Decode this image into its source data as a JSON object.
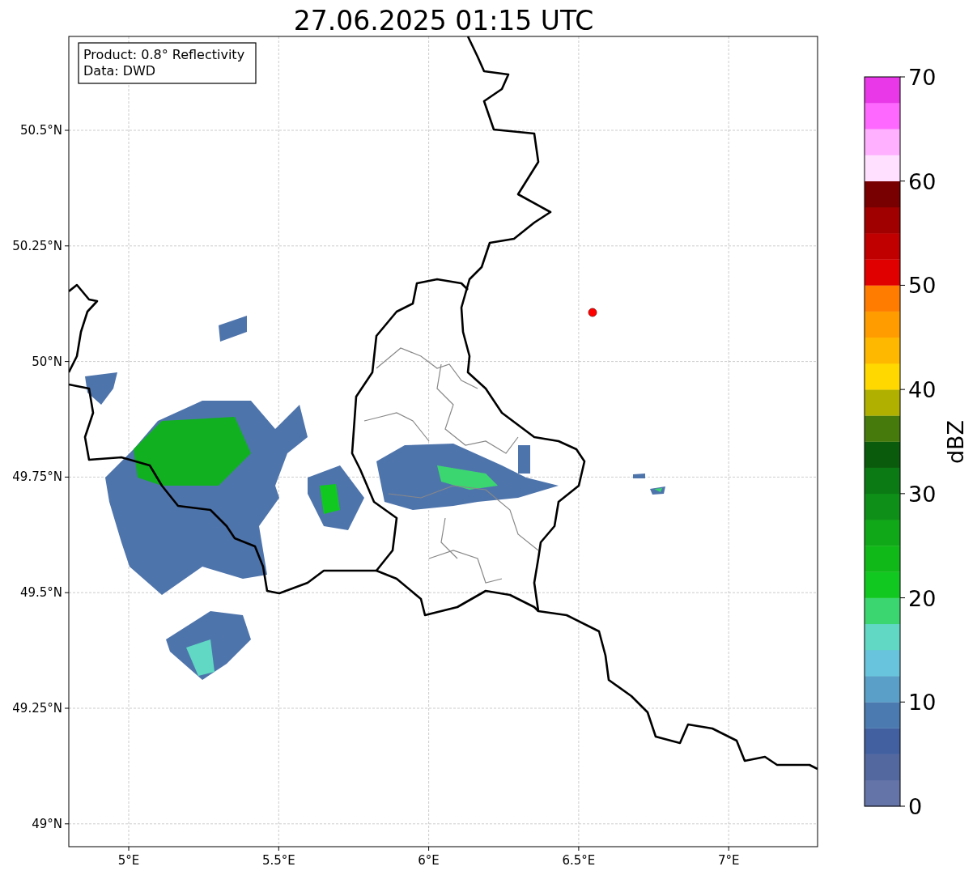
{
  "title": "27.06.2025 01:15 UTC",
  "info_box": [
    "Product: 0.8° Reflectivity",
    "Data: DWD"
  ],
  "y_ticks": [
    "50.5°N",
    "50.25°N",
    "50°N",
    "49.75°N",
    "49.5°N",
    "49.25°N",
    "49°N"
  ],
  "x_ticks": [
    "5°E",
    "5.5°E",
    "6°E",
    "6.5°E",
    "7°E"
  ],
  "colorbar": {
    "label": "dBZ",
    "ticks": [
      "70",
      "60",
      "50",
      "40",
      "30",
      "20",
      "10",
      "0"
    ],
    "bins": [
      {
        "color": "#6473a8"
      },
      {
        "color": "#5468a0"
      },
      {
        "color": "#4260a0"
      },
      {
        "color": "#4a7ab0"
      },
      {
        "color": "#5a9fc8"
      },
      {
        "color": "#68c4dc"
      },
      {
        "color": "#60d8c4"
      },
      {
        "color": "#3cd670"
      },
      {
        "color": "#10c820"
      },
      {
        "color": "#10b818"
      },
      {
        "color": "#10a818"
      },
      {
        "color": "#0e9018"
      },
      {
        "color": "#0c7a14"
      },
      {
        "color": "#0a5c0c"
      },
      {
        "color": "#467a0c"
      },
      {
        "color": "#b0b000"
      },
      {
        "color": "#ffd800"
      },
      {
        "color": "#ffb800"
      },
      {
        "color": "#ff9c00"
      },
      {
        "color": "#ff7c00"
      },
      {
        "color": "#e00000"
      },
      {
        "color": "#c00000"
      },
      {
        "color": "#a00000"
      },
      {
        "color": "#780000"
      },
      {
        "color": "#ffe0ff"
      },
      {
        "color": "#ffb0ff"
      },
      {
        "color": "#ff68ff"
      },
      {
        "color": "#e838e8"
      }
    ]
  }
}
